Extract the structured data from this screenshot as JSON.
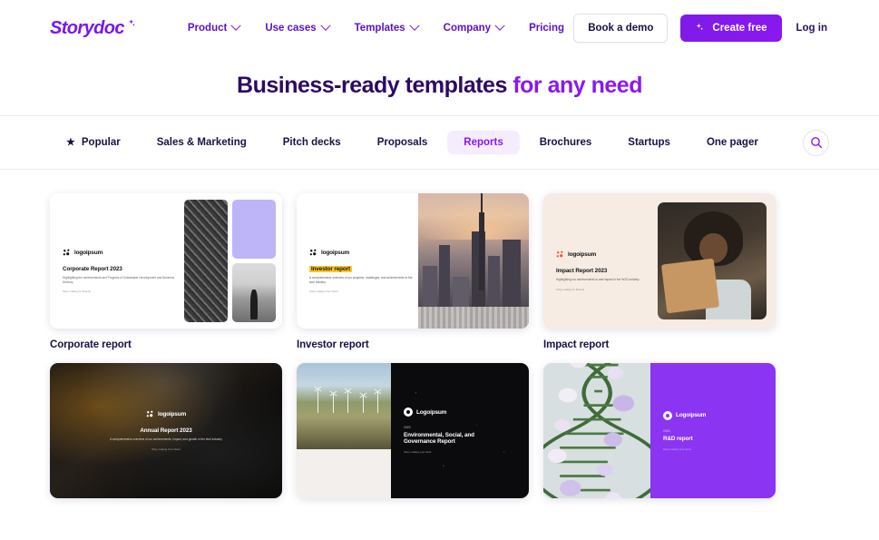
{
  "header": {
    "logo": "Storydoc",
    "nav": [
      {
        "label": "Product",
        "has_chevron": true
      },
      {
        "label": "Use cases",
        "has_chevron": true
      },
      {
        "label": "Templates",
        "has_chevron": true
      },
      {
        "label": "Company",
        "has_chevron": true
      },
      {
        "label": "Pricing",
        "has_chevron": false
      }
    ],
    "book_demo": "Book a demo",
    "create_free": "Create free",
    "login": "Log in",
    "brand_color": "#7b16e8"
  },
  "hero": {
    "title_dark": "Business-ready templates",
    "title_accent": "for any need",
    "dark_color": "#2d0a63",
    "accent_color": "#8a18f0"
  },
  "tabs": {
    "items": [
      {
        "label": "Popular",
        "icon": "star-icon",
        "active": false
      },
      {
        "label": "Sales & Marketing",
        "active": false
      },
      {
        "label": "Pitch decks",
        "active": false
      },
      {
        "label": "Proposals",
        "active": false
      },
      {
        "label": "Reports",
        "active": true
      },
      {
        "label": "Brochures",
        "active": false
      },
      {
        "label": "Startups",
        "active": false
      },
      {
        "label": "One pager",
        "active": false
      }
    ],
    "active_label": "Reports",
    "active_bg": "#f5edfe",
    "search_icon": "search-icon"
  },
  "cards": [
    {
      "title": "Corporate report",
      "brand": "logoipsum",
      "slide_title": "Corporate Report 2023",
      "slide_sub": "Highlighting the achievements and Progress of Sustainable Development and Business Delivery",
      "slide_meta": "Story making for Brands"
    },
    {
      "title": "Investor report",
      "brand": "logoipsum",
      "slide_title": "Investor report",
      "slide_sub": "A comprehensive overview of our progress, challenges, and achievements in the tech industry",
      "slide_meta": "Story making Your Client"
    },
    {
      "title": "Impact report",
      "brand": "logoipsum",
      "slide_title": "Impact Report 2023",
      "slide_sub": "Highlighting our achievements in and impact in the NGO Industry",
      "slide_meta": "Story making for Brands"
    },
    {
      "title": "",
      "brand": "logoipsum",
      "slide_title": "Annual Report 2023",
      "slide_sub": "A comprehensive overview of our achievements, impact, and growth in the tech industry",
      "slide_meta": "Story making Your Client"
    },
    {
      "title": "",
      "brand": "Logoipsum",
      "slide_year": "2023",
      "slide_title": "Environmental, Social, and Governance Report",
      "slide_meta": "Story making your deck"
    },
    {
      "title": "",
      "brand": "Logoipsum",
      "slide_year": "2023",
      "slide_title": "R&D report",
      "slide_meta": "Story making Your Deck"
    }
  ]
}
